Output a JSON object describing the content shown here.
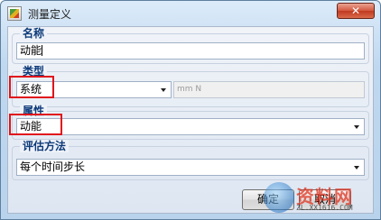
{
  "window": {
    "title": "测量定义",
    "close_glyph": "✕"
  },
  "name_group": {
    "label": "名称",
    "value": "动能"
  },
  "type_group": {
    "label": "类型",
    "selected": "系统",
    "units_field": "mm N"
  },
  "property_group": {
    "label": "属性",
    "selected": "动能"
  },
  "evaluation_group": {
    "label": "评估方法",
    "selected": "每个时间步长"
  },
  "buttons": {
    "ok": "确定",
    "cancel": "取消"
  },
  "watermark": {
    "text": "资料网",
    "url": "ZL.XX1616.COM"
  },
  "colors": {
    "highlight": "#e0141c",
    "group_label": "#0d3a7a"
  }
}
